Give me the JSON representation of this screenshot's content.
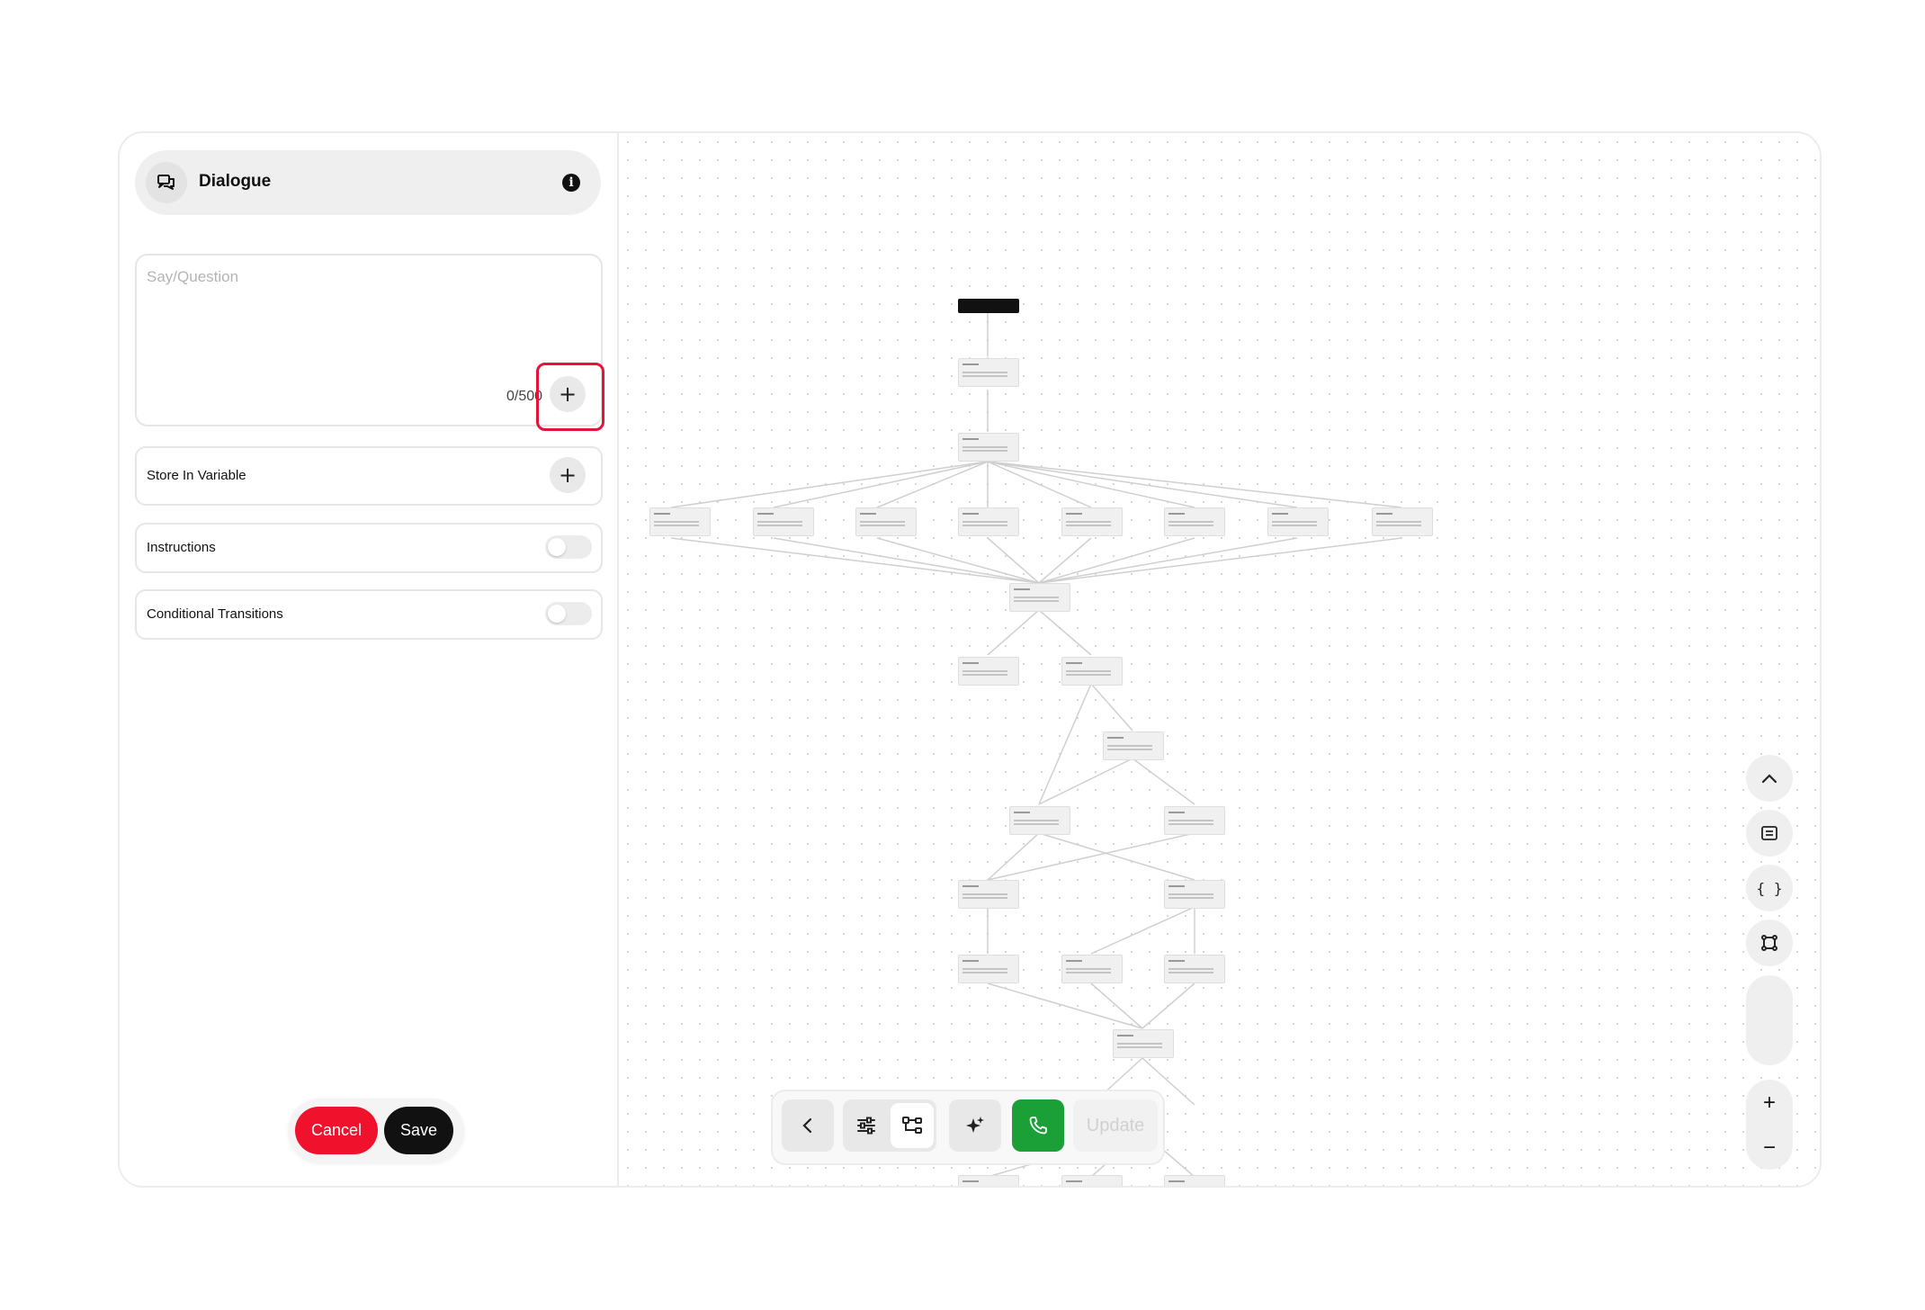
{
  "panel": {
    "title": "Dialogue",
    "say_placeholder": "Say/Question",
    "char_count": "0/500",
    "store_variable_label": "Store In Variable",
    "instructions_label": "Instructions",
    "instructions_enabled": false,
    "conditional_label": "Conditional Transitions",
    "conditional_enabled": false,
    "cancel_label": "Cancel",
    "save_label": "Save"
  },
  "toolbar": {
    "update_label": "Update"
  },
  "colors": {
    "cancel": "#f0112d",
    "save": "#111111",
    "call": "#1aa037",
    "highlight": "#e4133a"
  },
  "icons": [
    "chat-bubbles-icon",
    "info-icon",
    "plus-icon",
    "back-chevron-icon",
    "sliders-icon",
    "flow-icon",
    "sparkle-icon",
    "phone-icon",
    "chevron-up-icon",
    "document-icon",
    "braces-icon",
    "nodes-icon",
    "zoom-in-icon",
    "zoom-out-icon"
  ]
}
